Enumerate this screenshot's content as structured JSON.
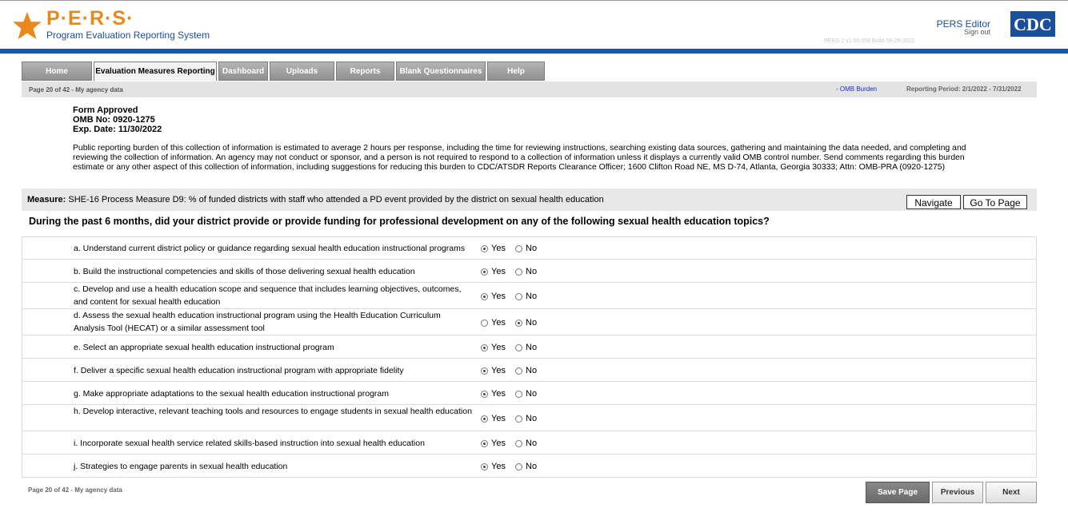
{
  "header": {
    "app_acronym": "P·E·R·S·",
    "app_name": "Program Evaluation Reporting System",
    "user_role": "PERS Editor",
    "signout": "Sign out",
    "version": "PERS-2 v1.00.058    Build 08-29-2022",
    "partner_logo": "CDC"
  },
  "tabs": [
    {
      "label": "Home"
    },
    {
      "label": "Evaluation Measures Reporting"
    },
    {
      "label": "Dashboard"
    },
    {
      "label": "Uploads"
    },
    {
      "label": "Reports"
    },
    {
      "label": "Blank Questionnaires"
    },
    {
      "label": "Help"
    }
  ],
  "subbar": {
    "page_info": "Page 20 of 42 - My agency data",
    "omb_link": "- OMB Burden",
    "reporting_period": "Reporting Period: 2/1/2022 - 7/31/2022"
  },
  "form_info": {
    "approved": "Form Approved",
    "omb_no": "OMB No: 0920-1275",
    "exp_date": "Exp. Date: 11/30/2022"
  },
  "burden_text": "Public reporting burden of this collection of information is estimated to average 2 hours per response, including the time for reviewing instructions, searching existing data sources, gathering and maintaining the data needed, and completing and reviewing the collection of information. An agency may not conduct or sponsor, and a person is not required to respond to a collection of information unless it displays a currently valid OMB control number. Send comments regarding this burden estimate or any other aspect of this collection of information, including suggestions for reducing this burden to CDC/ATSDR Reports Clearance Officer; 1600 Clifton Road NE, MS D-74, Atlanta, Georgia 30333; Attn: OMB-PRA (0920-1275)",
  "measure": {
    "label": "Measure:",
    "text": "SHE-16 Process Measure D9: % of funded districts with staff who attended a PD event provided by the district on sexual health education",
    "navigate_label": "Navigate",
    "goto_label": "Go To Page"
  },
  "question": "During the past 6 months, did your district provide or provide funding for professional development on any of the following sexual health education topics?",
  "options": {
    "yes": "Yes",
    "no": "No"
  },
  "items": [
    {
      "text": "a. Understand current district policy or guidance regarding sexual health education instructional programs",
      "answer": "Yes"
    },
    {
      "text": "b. Build the instructional competencies and skills of those delivering sexual health education",
      "answer": "Yes"
    },
    {
      "text": "c. Develop and use a health education scope and sequence that includes learning objectives, outcomes, and content for sexual health education",
      "answer": "Yes"
    },
    {
      "text": "d. Assess the sexual health education instructional program using the Health Education Curriculum Analysis Tool (HECAT) or a similar assessment tool",
      "answer": "No"
    },
    {
      "text": "e. Select an appropriate sexual health education instructional program",
      "answer": "Yes"
    },
    {
      "text": "f. Deliver a specific sexual health education instructional program with appropriate fidelity",
      "answer": "Yes"
    },
    {
      "text": "g. Make appropriate adaptations to the sexual health education instructional program",
      "answer": "Yes"
    },
    {
      "text": "h. Develop interactive, relevant teaching tools and resources to engage students in sexual health education",
      "answer": "Yes"
    },
    {
      "text": "i. Incorporate sexual health service related skills-based instruction into sexual health education",
      "answer": "Yes"
    },
    {
      "text": "j. Strategies to engage parents in sexual health education",
      "answer": "Yes"
    }
  ],
  "footer": {
    "page_info": "Page 20 of 42 - My agency data",
    "save_label": "Save Page",
    "previous_label": "Previous",
    "next_label": "Next"
  }
}
